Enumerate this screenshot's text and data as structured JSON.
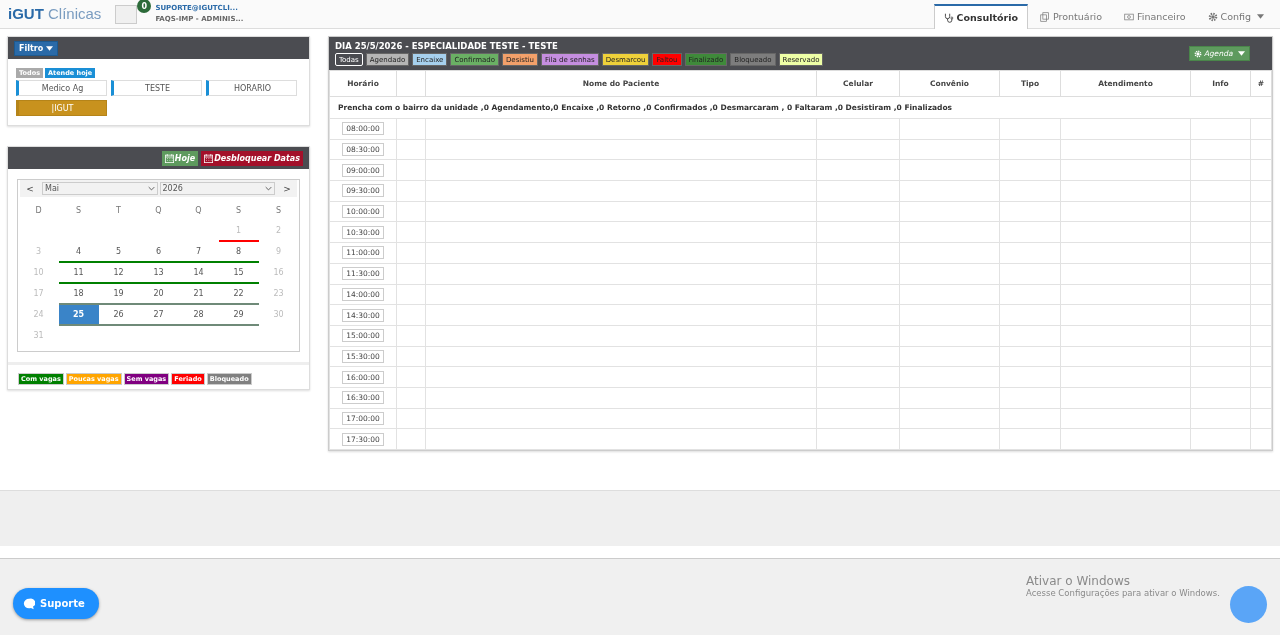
{
  "header": {
    "logo_bold": "iGUT",
    "logo_light": "Clínicas",
    "badge": "0",
    "user": "SUPORTE@IGUTCLI...",
    "role": "FAQS-IMP - ADMINIS..."
  },
  "nav_tabs": [
    {
      "label": "Consultório",
      "selected": true,
      "dropdown": false
    },
    {
      "label": "Prontuário",
      "selected": false,
      "dropdown": false
    },
    {
      "label": "Financeiro",
      "selected": false,
      "dropdown": false
    },
    {
      "label": "Config",
      "selected": false,
      "dropdown": true
    }
  ],
  "filter_panel": {
    "button": "Filtro",
    "chips": [
      {
        "label": "Todos",
        "color": "#aaaaaa"
      },
      {
        "label": "Atende hoje",
        "color": "#1a8fd6"
      }
    ],
    "professionals": [
      {
        "label": "Medico Ag",
        "selected": false
      },
      {
        "label": "TESTE",
        "selected": false
      },
      {
        "label": "HORARIO",
        "selected": false
      },
      {
        "label": "|IGUT",
        "selected": true
      }
    ]
  },
  "calendar_panel": {
    "today_button": "Hoje",
    "unlock_button": "Desbloquear Datas",
    "prev": "<",
    "next": ">",
    "month": "Mai",
    "year": "2026",
    "weekdays": [
      "D",
      "S",
      "T",
      "Q",
      "Q",
      "S",
      "S"
    ],
    "weeks": [
      [
        {
          "day": "1",
          "muted": true,
          "selected": false,
          "color": "#ff0000"
        },
        {
          "day": "2",
          "muted": true,
          "selected": false
        }
      ],
      [
        {
          "day": "3",
          "muted": true,
          "selected": false
        },
        {
          "day": "4",
          "muted": false,
          "selected": false,
          "color": "#008000"
        },
        {
          "day": "5",
          "muted": false,
          "selected": false,
          "color": "#008000"
        },
        {
          "day": "6",
          "muted": false,
          "selected": false,
          "color": "#008000"
        },
        {
          "day": "7",
          "muted": false,
          "selected": false,
          "color": "#008000"
        },
        {
          "day": "8",
          "muted": false,
          "selected": false,
          "color": "#008000"
        },
        {
          "day": "9",
          "muted": true,
          "selected": false
        }
      ],
      [
        {
          "day": "10",
          "muted": true,
          "selected": false
        },
        {
          "day": "11",
          "muted": false,
          "selected": false,
          "color": "#008000"
        },
        {
          "day": "12",
          "muted": false,
          "selected": false,
          "color": "#008000"
        },
        {
          "day": "13",
          "muted": false,
          "selected": false,
          "color": "#008000"
        },
        {
          "day": "14",
          "muted": false,
          "selected": false,
          "color": "#008000"
        },
        {
          "day": "15",
          "muted": false,
          "selected": false,
          "color": "#008000"
        },
        {
          "day": "16",
          "muted": true,
          "selected": false
        }
      ],
      [
        {
          "day": "17",
          "muted": true,
          "selected": false
        },
        {
          "day": "18",
          "muted": false,
          "selected": false,
          "color": "#6f8a78"
        },
        {
          "day": "19",
          "muted": false,
          "selected": false,
          "color": "#6f8a78"
        },
        {
          "day": "20",
          "muted": false,
          "selected": false,
          "color": "#6f8a78"
        },
        {
          "day": "21",
          "muted": false,
          "selected": false,
          "color": "#6f8a78"
        },
        {
          "day": "22",
          "muted": false,
          "selected": false,
          "color": "#6f8a78"
        },
        {
          "day": "23",
          "muted": true,
          "selected": false
        }
      ],
      [
        {
          "day": "24",
          "muted": true,
          "selected": false
        },
        {
          "day": "25",
          "muted": false,
          "selected": true,
          "color": "#6f8a78"
        },
        {
          "day": "26",
          "muted": false,
          "selected": false,
          "color": "#6f8a78"
        },
        {
          "day": "27",
          "muted": false,
          "selected": false,
          "color": "#6f8a78"
        },
        {
          "day": "28",
          "muted": false,
          "selected": false,
          "color": "#6f8a78"
        },
        {
          "day": "29",
          "muted": false,
          "selected": false,
          "color": "#6f8a78"
        },
        {
          "day": "30",
          "muted": true,
          "selected": false
        }
      ],
      [
        {
          "day": "31",
          "muted": true,
          "selected": false
        }
      ]
    ],
    "legend": [
      {
        "label": "Com vagas",
        "color": "#008000"
      },
      {
        "label": "Poucas vagas",
        "color": "#ffa500"
      },
      {
        "label": "Sem vagas",
        "color": "#800080"
      },
      {
        "label": "Feriado",
        "color": "#ff0000"
      },
      {
        "label": "Bloqueado",
        "color": "#808080"
      }
    ]
  },
  "schedule": {
    "title": "DIA 25/5/2026 - ESPECIALIDADE TESTE - TESTE",
    "agenda_button": "Agenda",
    "status_filters": [
      {
        "label": "Todas",
        "color": "#4a4b50",
        "selected": true
      },
      {
        "label": "Agendado",
        "color": "#b5b5b5",
        "selected": false
      },
      {
        "label": "Encaixe",
        "color": "#a6d0ee",
        "selected": false
      },
      {
        "label": "Confirmado",
        "color": "#6ab064",
        "selected": false
      },
      {
        "label": "Desistiu",
        "color": "#f3a06a",
        "selected": false
      },
      {
        "label": "Fila de senhas",
        "color": "#c58ee0",
        "selected": false
      },
      {
        "label": "Desmarcou",
        "color": "#efd13a",
        "selected": false
      },
      {
        "label": "Faltou",
        "color": "#ff0000",
        "selected": false
      },
      {
        "label": "Finalizado",
        "color": "#3f8a3a",
        "selected": false
      },
      {
        "label": "Bloqueado",
        "color": "#7d7d7d",
        "selected": false
      },
      {
        "label": "Reservado",
        "color": "#eeffa6",
        "selected": false
      }
    ],
    "columns": [
      {
        "kind": "text",
        "label": "Horário"
      },
      {
        "kind": "blank"
      },
      {
        "kind": "text",
        "label": "Nome do Paciente"
      },
      {
        "kind": "text",
        "label": "Celular"
      },
      {
        "kind": "text",
        "label": "Convênio"
      },
      {
        "kind": "text",
        "label": "Tipo"
      },
      {
        "kind": "text",
        "label": "Atendimento"
      },
      {
        "kind": "text",
        "label": "Info"
      },
      {
        "kind": "text",
        "label": "#"
      }
    ],
    "summary": "Prencha com o bairro da unidade ,0 Agendamento,0 Encaixe ,0 Retorno ,0 Confirmados ,0 Desmarcaram , 0 Faltaram ,0 Desistiram ,0 Finalizados",
    "times": [
      "08:00:00",
      "08:30:00",
      "09:00:00",
      "09:30:00",
      "10:00:00",
      "10:30:00",
      "11:00:00",
      "11:30:00",
      "14:00:00",
      "14:30:00",
      "15:00:00",
      "15:30:00",
      "16:00:00",
      "16:30:00",
      "17:00:00",
      "17:30:00"
    ]
  },
  "support_button": "Suporte",
  "windows_notice": {
    "title": "Ativar o Windows",
    "text": "Acesse Configurações para ativar o Windows."
  }
}
